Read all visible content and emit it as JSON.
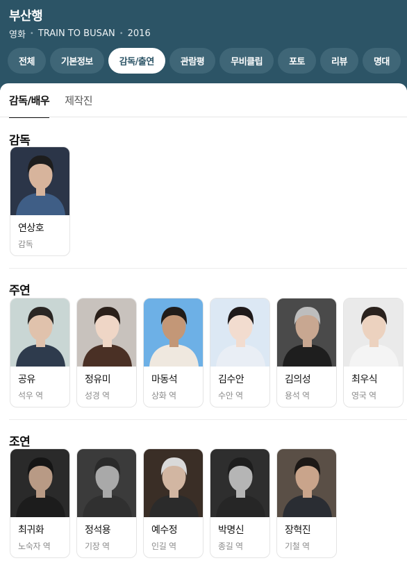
{
  "header": {
    "title": "부산행",
    "meta": [
      "영화",
      "TRAIN TO BUSAN",
      "2016"
    ],
    "tabs": [
      {
        "label": "전체",
        "active": false
      },
      {
        "label": "기본정보",
        "active": false
      },
      {
        "label": "감독/출연",
        "active": true
      },
      {
        "label": "관람평",
        "active": false
      },
      {
        "label": "무비클립",
        "active": false
      },
      {
        "label": "포토",
        "active": false
      },
      {
        "label": "리뷰",
        "active": false
      },
      {
        "label": "명대",
        "active": false
      }
    ]
  },
  "subtabs": [
    {
      "label": "감독/배우",
      "active": true
    },
    {
      "label": "제작진",
      "active": false
    }
  ],
  "sections": [
    {
      "title": "감독",
      "people": [
        {
          "name": "연상호",
          "role": "감독",
          "bg": "#2b3548",
          "skin": "#d7b49c",
          "hair": "#1d1d1d",
          "shirt": "#3f5e86"
        }
      ]
    },
    {
      "title": "주연",
      "people": [
        {
          "name": "공유",
          "role": "석우 역",
          "bg": "#c9d6d4",
          "skin": "#e0c2ac",
          "hair": "#2a2623",
          "shirt": "#2e3b4d"
        },
        {
          "name": "정유미",
          "role": "성경 역",
          "bg": "#c8c2bd",
          "skin": "#efd6c6",
          "hair": "#2b201a",
          "shirt": "#4a3025"
        },
        {
          "name": "마동석",
          "role": "상화 역",
          "bg": "#6db0e6",
          "skin": "#c39777",
          "hair": "#211c19",
          "shirt": "#efe8df"
        },
        {
          "name": "김수안",
          "role": "수안 역",
          "bg": "#dce8f4",
          "skin": "#f2dccf",
          "hair": "#1f1a1a",
          "shirt": "#e9eef5"
        },
        {
          "name": "김의성",
          "role": "용석 역",
          "bg": "#4a4a4a",
          "skin": "#c8a791",
          "hair": "#bdbdbd",
          "shirt": "#1e1e1e"
        },
        {
          "name": "최우식",
          "role": "영국 역",
          "bg": "#eaeaea",
          "skin": "#ecd2bf",
          "hair": "#2a221e",
          "shirt": "#f4f4f4"
        }
      ]
    },
    {
      "title": "조연",
      "people": [
        {
          "name": "최귀화",
          "role": "노숙자 역",
          "bg": "#2a2a2a",
          "skin": "#b89a85",
          "hair": "#151515",
          "shirt": "#1c1c1c"
        },
        {
          "name": "정석용",
          "role": "기장 역",
          "bg": "#3b3b3b",
          "skin": "#a9a9a9",
          "hair": "#2a2a2a",
          "shirt": "#303030"
        },
        {
          "name": "예수정",
          "role": "인길 역",
          "bg": "#3a2e26",
          "skin": "#d2b6a2",
          "hair": "#d9d9d9",
          "shirt": "#2b2b2b"
        },
        {
          "name": "박명신",
          "role": "종길 역",
          "bg": "#2e2e2e",
          "skin": "#b5b5b5",
          "hair": "#1d1d1d",
          "shirt": "#262626"
        },
        {
          "name": "장혁진",
          "role": "기철 역",
          "bg": "#5a4f46",
          "skin": "#c9a48b",
          "hair": "#1c1816",
          "shirt": "#2a2d33"
        }
      ]
    }
  ]
}
